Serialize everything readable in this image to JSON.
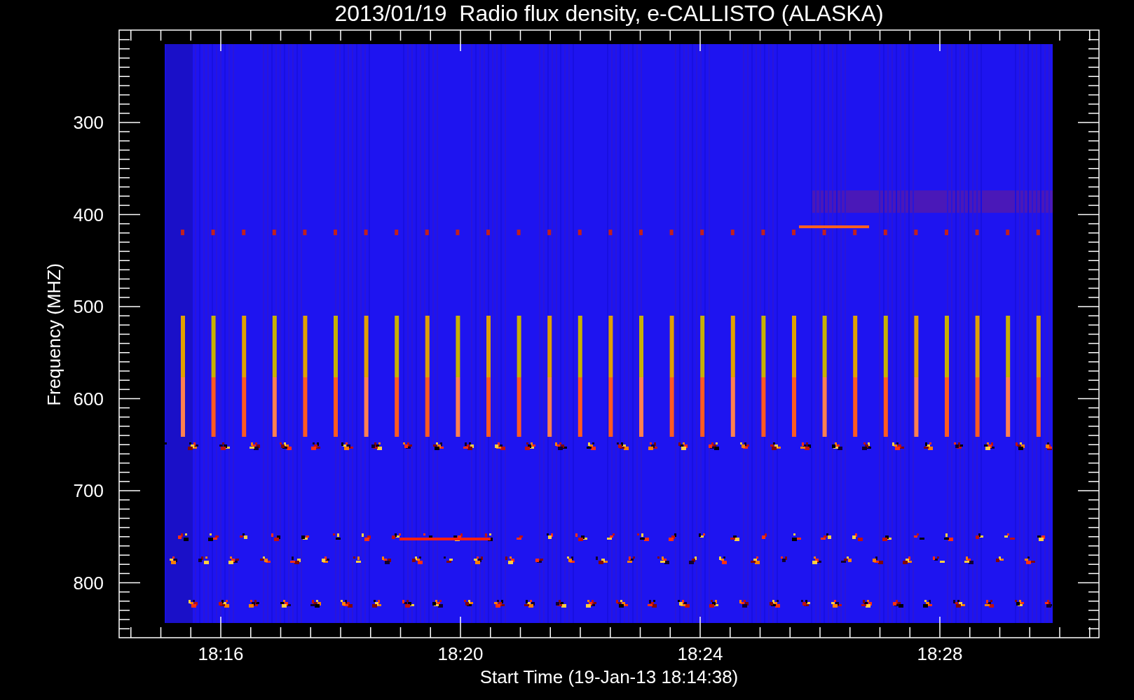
{
  "title": "2013/01/19  Radio flux density, e-CALLISTO (ALASKA)",
  "y_axis": {
    "label": "Frequency (MHZ)",
    "ticks": [
      "300",
      "400",
      "500",
      "600",
      "700",
      "800"
    ]
  },
  "x_axis": {
    "label": "Start Time (19-Jan-13 18:14:38)",
    "ticks": [
      "18:16",
      "18:20",
      "18:24",
      "18:28"
    ]
  }
}
